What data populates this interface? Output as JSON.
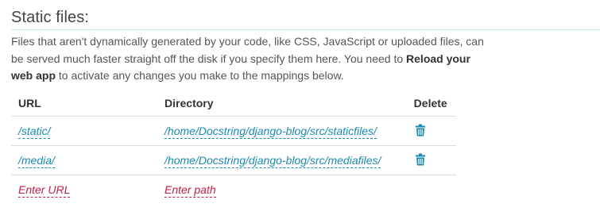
{
  "section": {
    "title": "Static files:",
    "description_part1": "Files that aren't dynamically generated by your code, like CSS, JavaScript or uploaded files, can be served much faster straight off the disk if you specify them here. You need to ",
    "description_bold": "Reload your web app",
    "description_part2": " to activate any changes you make to the mappings below."
  },
  "table": {
    "headers": {
      "url": "URL",
      "directory": "Directory",
      "delete": "Delete"
    },
    "rows": [
      {
        "url": "/static/",
        "directory": "/home/Docstring/django-blog/src/staticfiles/",
        "delete_icon": "trash-icon"
      },
      {
        "url": "/media/",
        "directory": "/home/Docstring/django-blog/src/mediafiles/",
        "delete_icon": "trash-icon"
      }
    ],
    "new_row": {
      "url_placeholder": "Enter URL",
      "path_placeholder": "Enter path"
    }
  },
  "colors": {
    "link": "#1a8ab0",
    "placeholder": "#c32048",
    "title_rule": "#c9e6ec"
  }
}
